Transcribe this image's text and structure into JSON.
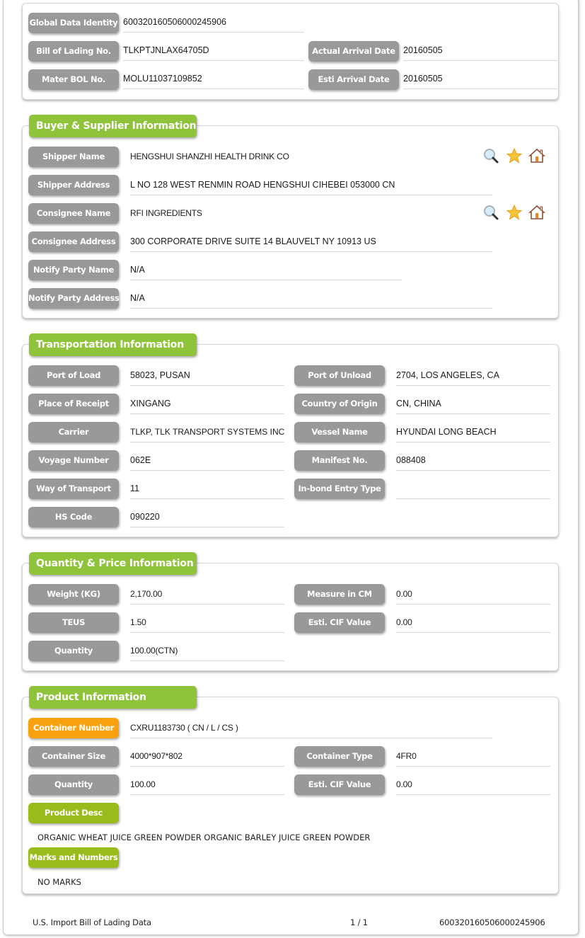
{
  "header": {
    "global_data_identity": {
      "label": "Global Data Identity",
      "value": "600320160506000245906"
    },
    "bill_of_lading": {
      "label": "Bill of Lading No.",
      "value": "TLKPTJNLAX64705D"
    },
    "actual_arrival": {
      "label": "Actual Arrival Date",
      "value": "20160505"
    },
    "master_bol": {
      "label": "Mater BOL No.",
      "value": "MOLU11037109852"
    },
    "esti_arrival": {
      "label": "Esti Arrival Date",
      "value": "20160505"
    }
  },
  "buyer_supplier": {
    "title": "Buyer & Supplier Information",
    "shipper_name": {
      "label": "Shipper Name",
      "value": "HENGSHUI SHANZHI HEALTH DRINK CO"
    },
    "shipper_address": {
      "label": "Shipper Address",
      "value": "L NO 128 WEST RENMIN ROAD HENGSHUI CIHEBEI 053000 CN"
    },
    "consignee_name": {
      "label": "Consignee Name",
      "value": "RFI INGREDIENTS"
    },
    "consignee_address": {
      "label": "Consignee Address",
      "value": "300 CORPORATE DRIVE SUITE 14 BLAUVELT NY 10913 US"
    },
    "notify_party_name": {
      "label": "Notify Party Name",
      "value": "N/A"
    },
    "notify_party_address": {
      "label": "Notify Party Address",
      "value": "N/A"
    },
    "icons": [
      "search-icon",
      "star-icon",
      "home-icon"
    ]
  },
  "transportation": {
    "title": "Transportation Information",
    "port_of_load": {
      "label": "Port of Load",
      "value": "58023, PUSAN"
    },
    "port_of_unload": {
      "label": "Port of Unload",
      "value": "2704, LOS ANGELES, CA"
    },
    "place_of_receipt": {
      "label": "Place of Receipt",
      "value": "XINGANG"
    },
    "country_of_origin": {
      "label": "Country of Origin",
      "value": "CN, CHINA"
    },
    "carrier": {
      "label": "Carrier",
      "value": "TLKP, TLK TRANSPORT SYSTEMS INC"
    },
    "vessel_name": {
      "label": "Vessel Name",
      "value": "HYUNDAI LONG BEACH"
    },
    "voyage_number": {
      "label": "Voyage Number",
      "value": "062E"
    },
    "manifest_no": {
      "label": "Manifest No.",
      "value": "088408"
    },
    "way_of_transport": {
      "label": "Way of Transport",
      "value": "11"
    },
    "inbond_entry_type": {
      "label": "In-bond Entry Type",
      "value": ""
    },
    "hs_code": {
      "label": "HS Code",
      "value": "090220"
    }
  },
  "quantity_price": {
    "title": "Quantity & Price Information",
    "weight": {
      "label": "Weight (KG)",
      "value": "2,170.00"
    },
    "measure": {
      "label": "Measure in CM",
      "value": "0.00"
    },
    "teus": {
      "label": "TEUS",
      "value": "1.50"
    },
    "esti_cif": {
      "label": "Esti. CIF Value",
      "value": "0.00"
    },
    "quantity": {
      "label": "Quantity",
      "value": "100.00(CTN)"
    }
  },
  "product": {
    "title": "Product Information",
    "container_number": {
      "label": "Container Number",
      "value": "CXRU1183730 ( CN / L / CS )"
    },
    "container_size": {
      "label": "Container Size",
      "value": "4000*907*802"
    },
    "container_type": {
      "label": "Container Type",
      "value": "4FR0"
    },
    "quantity": {
      "label": "Quantity",
      "value": "100.00"
    },
    "esti_cif": {
      "label": "Esti. CIF Value",
      "value": "0.00"
    },
    "product_desc": {
      "label": "Product Desc",
      "value": "ORGANIC WHEAT JUICE GREEN POWDER ORGANIC BARLEY JUICE GREEN POWDER"
    },
    "marks_numbers": {
      "label": "Marks and Numbers",
      "value": "NO MARKS"
    }
  },
  "footer": {
    "source": "U.S. Import Bill of Lading Data",
    "page": "1 / 1",
    "id": "600320160506000245906"
  },
  "colors": {
    "section_green": "#8fc33a",
    "label_gray": "#999999",
    "label_orange": "#f9a20f",
    "label_green": "#99bb1b"
  }
}
